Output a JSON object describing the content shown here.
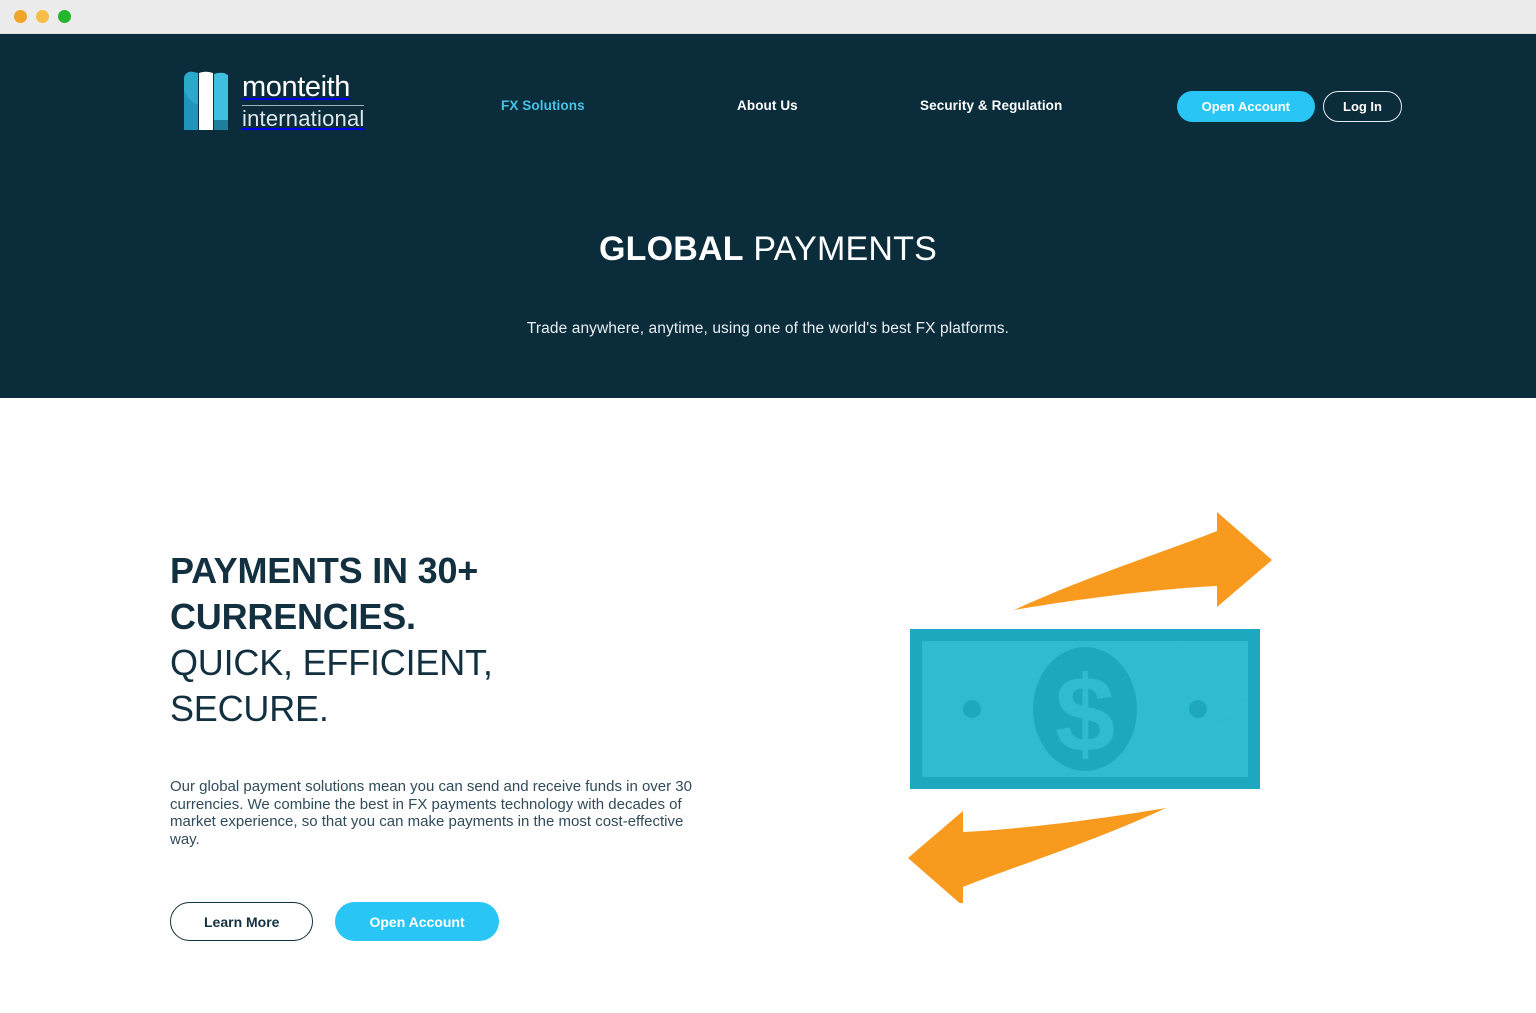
{
  "window": {
    "traffic_lights": [
      "close-orange",
      "minimize-yellow",
      "maximize-green"
    ]
  },
  "brand": {
    "name": "monteith",
    "sub": "international",
    "logo_colors": {
      "outer": "#2aa9c9",
      "inner": "#ffffff",
      "accent": "#45c3e8"
    }
  },
  "nav": {
    "links": [
      {
        "label": "FX Solutions",
        "active": true
      },
      {
        "label": "About Us",
        "active": false
      },
      {
        "label": "Security & Regulation",
        "active": false
      }
    ],
    "open_account_label": "Open Account",
    "log_in_label": "Log In"
  },
  "hero": {
    "title_bold": "GLOBAL",
    "title_light": "PAYMENTS",
    "subtitle": "Trade anywhere, anytime, using one of the world's best FX platforms.",
    "background": "#0a2c3b"
  },
  "main": {
    "headline_bold_line_1": "PAYMENTS IN 30+",
    "headline_bold_line_2": "CURRENCIES.",
    "headline_light_line_1": "QUICK, EFFICIENT,",
    "headline_light_line_2": "SECURE.",
    "body": "Our global payment solutions mean you can send and receive funds in over 30 currencies. We combine the best in FX payments technology with decades of market experience, so that you can make payments in the most cost-effective way.",
    "learn_more_label": "Learn More",
    "open_account_label": "Open Account"
  },
  "illustration": {
    "name": "banknote-with-exchange-arrows",
    "currency_symbol": "$",
    "note_color": "#1ea8c0",
    "note_inner_color": "#2fbcd2",
    "arrow_color": "#f79a1e"
  },
  "colors": {
    "accent_cyan": "#29c6f5",
    "dark_navy": "#0a2c3b",
    "text_dark": "#12303f",
    "orange": "#f79a1e",
    "teal": "#1ea8c0"
  }
}
